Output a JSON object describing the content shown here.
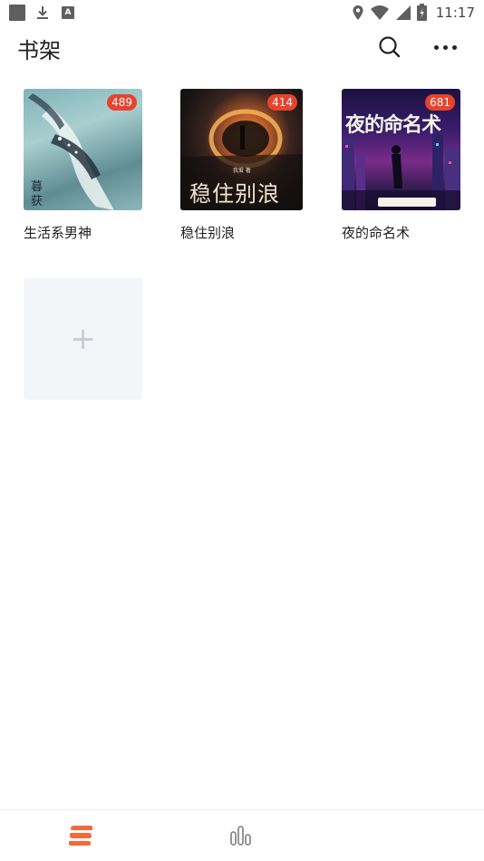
{
  "status_bar": {
    "time": "11:17",
    "icons": [
      "notification-square-icon",
      "download-icon",
      "a-icon",
      "location-icon",
      "wifi-icon",
      "signal-icon",
      "battery-icon"
    ]
  },
  "header": {
    "title": "书架",
    "search_icon": "search-icon",
    "more_icon": "more-icon"
  },
  "books": [
    {
      "title": "生活系男神",
      "badge": "489"
    },
    {
      "title": "稳住别浪",
      "badge": "414",
      "cover_text": "稳住别浪"
    },
    {
      "title": "夜的命名术",
      "badge": "681",
      "cover_text": "夜的命名术"
    }
  ],
  "add_tile": {
    "symbol": "+"
  },
  "tabbar": {
    "tabs": [
      {
        "name": "shelf",
        "icon": "shelf-icon",
        "active": true
      },
      {
        "name": "discover",
        "icon": "discover-icon",
        "active": false
      }
    ]
  },
  "colors": {
    "badge": "#e8432e",
    "active_tab": "#f26a3a",
    "inactive_tab": "#8a8a8a",
    "add_tile_bg": "#f4f5f8"
  }
}
